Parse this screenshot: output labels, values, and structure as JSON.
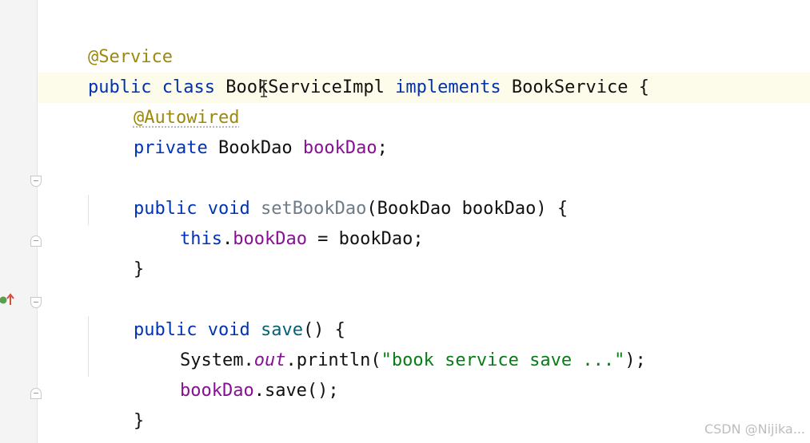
{
  "code": {
    "line1": {
      "annotation": "@Service"
    },
    "line2": {
      "kw1": "public",
      "kw2": "class",
      "class_name": "BookServiceImpl",
      "kw3": "implements",
      "interface_name": "BookService",
      "brace": "{"
    },
    "line3": {
      "annotation": "@Autowired"
    },
    "line4": {
      "kw": "private",
      "type": "BookDao",
      "field": "bookDao",
      "semi": ";"
    },
    "line6": {
      "kw1": "public",
      "kw2": "void",
      "method": "setBookDao",
      "params": "(BookDao bookDao) {"
    },
    "line7": {
      "kw": "this",
      "dot": ".",
      "field": "bookDao",
      "rest": " = bookDao;"
    },
    "line8": {
      "brace": "}"
    },
    "line10": {
      "kw1": "public",
      "kw2": "void",
      "method": "save",
      "rest": "() {"
    },
    "line11": {
      "cls": "System.",
      "out": "out",
      "call": ".println(",
      "str": "\"book service save ...\"",
      "end": ");"
    },
    "line12": {
      "field": "bookDao",
      "rest": ".save();"
    },
    "line13": {
      "brace": "}"
    },
    "line14": {
      "brace": "}"
    }
  },
  "icons": {
    "fold": "fold-marker-icon",
    "override": "implements-method-icon",
    "cursor": "text-cursor-icon"
  },
  "watermark": "CSDN @Nijika...",
  "colors": {
    "keyword": "#0033b3",
    "annotation": "#9e880d",
    "field": "#871094",
    "method": "#00627a",
    "string": "#067d17",
    "caret_row": "#fdfbe9"
  }
}
